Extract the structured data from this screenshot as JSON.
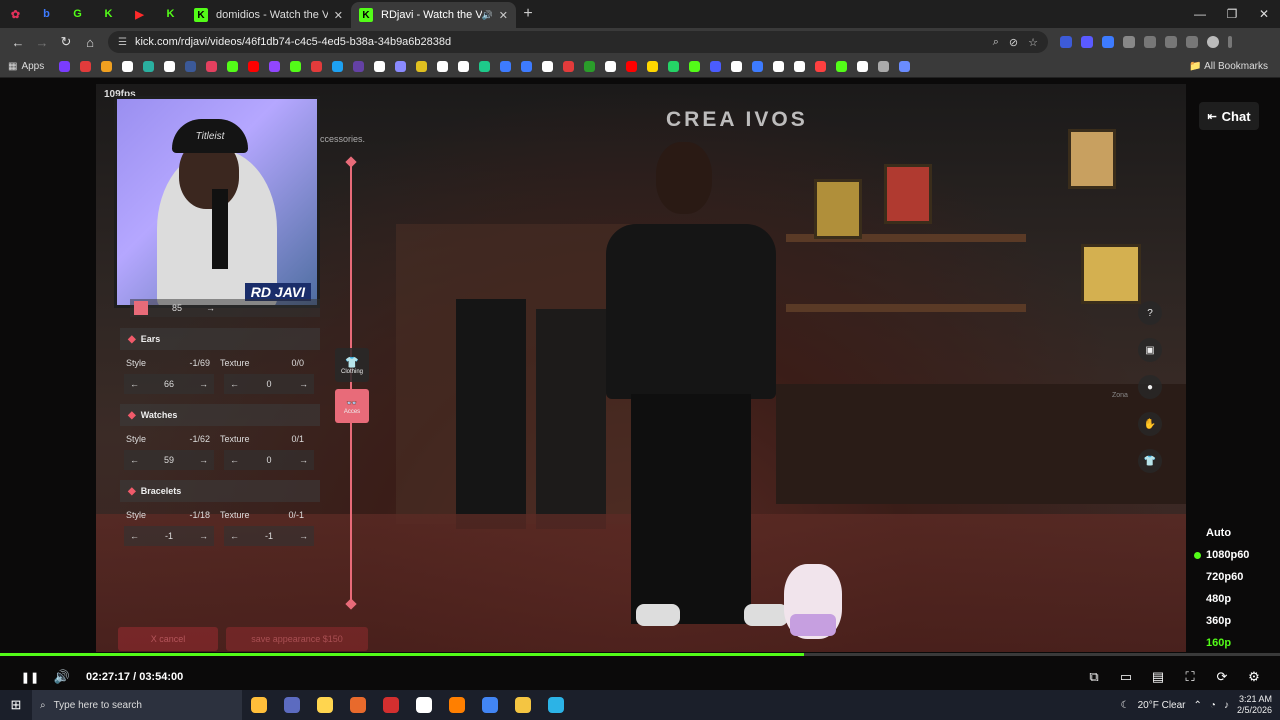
{
  "browser": {
    "mini_tabs": [
      {
        "glyph": "✿",
        "color": "#e0315a"
      },
      {
        "glyph": "b",
        "color": "#3d7bff"
      },
      {
        "glyph": "G",
        "color": "#53fc18"
      },
      {
        "glyph": "K",
        "color": "#53fc18"
      },
      {
        "glyph": "▶",
        "color": "#ff2a2a"
      },
      {
        "glyph": "K",
        "color": "#53fc18"
      }
    ],
    "tabs": [
      {
        "title": "domidios - Watch the VOD on",
        "fav": "K",
        "close": "✕"
      },
      {
        "title": "RDjavi - Watch the VOD on",
        "fav": "K",
        "close": "✕",
        "audio": "🔊"
      }
    ],
    "new_tab": "+",
    "window_controls": [
      "—",
      "❐",
      "✕"
    ],
    "url": "kick.com/rdjavi/videos/46f1db74-c4c5-4ed5-b38a-34b9a6b2838d",
    "bookmarks_apps": "Apps",
    "all_bookmarks": "All Bookmarks",
    "bookmark_colors": [
      "#7a3cff",
      "#e23b3b",
      "#f0a020",
      "#ffffff",
      "#2ab0a0",
      "#ffffff",
      "#3b5998",
      "#e4405f",
      "#53fc18",
      "#ff0000",
      "#9146ff",
      "#53fc18",
      "#e23b3b",
      "#1da1f2",
      "#6441a5",
      "#ffffff",
      "#8a8aff",
      "#e0c020",
      "#ffffff",
      "#ffffff",
      "#1ec98a",
      "#3d7bff",
      "#3d7bff",
      "#ffffff",
      "#e23b3b",
      "#2a9d2a",
      "#ffffff",
      "#ff0000",
      "#ffd700",
      "#25d366",
      "#53fc18",
      "#4a5cff",
      "#ffffff",
      "#3d7bff",
      "#ffffff",
      "#ffffff",
      "#ff4040",
      "#53fc18",
      "#ffffff",
      "#aaaaaa",
      "#6a8cff"
    ]
  },
  "stream": {
    "fps": "109fps",
    "accessories_text": "ccessories.",
    "watermark": "CREA IVOS",
    "webcam_name": "RD JAVI",
    "webcam_hat": "Titleist",
    "chat_label": "Chat",
    "top_value": "85",
    "sections": [
      {
        "title": "Ears",
        "style_label": "Style",
        "style_range": "-1/69",
        "tex_label": "Texture",
        "tex_range": "0/0",
        "style_val": "66",
        "tex_val": "0"
      },
      {
        "title": "Watches",
        "style_label": "Style",
        "style_range": "-1/62",
        "tex_label": "Texture",
        "tex_range": "0/1",
        "style_val": "59",
        "tex_val": "0"
      },
      {
        "title": "Bracelets",
        "style_label": "Style",
        "style_range": "-1/18",
        "tex_label": "Texture",
        "tex_range": "0/-1",
        "style_val": "-1",
        "tex_val": "-1"
      }
    ],
    "side_buttons": [
      {
        "label": "Clothing",
        "icon": "👕"
      },
      {
        "label": "Acces",
        "icon": "👓"
      }
    ],
    "cancel_label": "X cancel",
    "save_label": "save appearance $150",
    "zone_label": "Zona",
    "right_icons": [
      "?",
      "▣",
      "●",
      "✋",
      "👕"
    ]
  },
  "player": {
    "progress_fraction": 0.6285,
    "time": "02:27:17 / 03:54:00",
    "quality_options": [
      "Auto",
      "1080p60",
      "720p60",
      "480p",
      "360p",
      "160p"
    ],
    "quality_selected": "1080p60",
    "play_icon": "❚❚",
    "volume_icon": "🔊",
    "right_controls": [
      "⧉",
      "▭",
      "▤",
      "⛶",
      "⟳",
      "⚙"
    ]
  },
  "taskbar": {
    "search_placeholder": "Type here to search",
    "apps": [
      "#ffbe3a",
      "#5c6bc0",
      "#ffd54f",
      "#e86a2c",
      "#d32f2f",
      "#ffffff",
      "#ff7f00",
      "#4285f4",
      "#f4c542",
      "#2cb3e6"
    ],
    "weather": "20°F Clear",
    "time": "3:21 AM",
    "date": "2/5/2026"
  }
}
